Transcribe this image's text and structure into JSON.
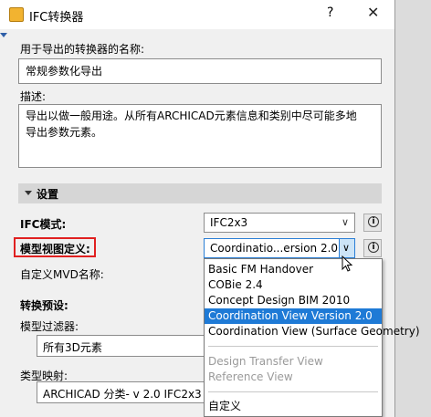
{
  "window": {
    "title": "IFC转换器",
    "help": "?",
    "close": "✕"
  },
  "name_label": "用于导出的转换器的名称:",
  "name_value": "常规参数化导出",
  "desc_label": "描述:",
  "desc_line1": "导出以做一般用途。从所有ARCHICAD元素信息和类别中尽可能多地",
  "desc_line2": "导出参数元素。",
  "section_title": "设置",
  "ifc_mode_label": "IFC模式:",
  "ifc_mode_value": "IFC2x3",
  "mvd_label": "模型视图定义:",
  "mvd_value": "Coordinatio...ersion 2.0",
  "custom_mvd_label": "自定义MVD名称:",
  "preset_label": "转换预设:",
  "filter_label": "模型过滤器:",
  "filter_value": "所有3D元素",
  "mapping_label": "类型映射:",
  "mapping_value": "ARCHICAD 分类- v 2.0 IFC2x3",
  "dropdown_items": [
    "Basic FM Handover",
    "COBie 2.4",
    "Concept Design BIM 2010",
    "Coordination View Version 2.0",
    "Coordination View (Surface Geometry)"
  ],
  "dropdown_disabled": [
    "Design Transfer View",
    "Reference View"
  ],
  "dropdown_custom": "自定义"
}
